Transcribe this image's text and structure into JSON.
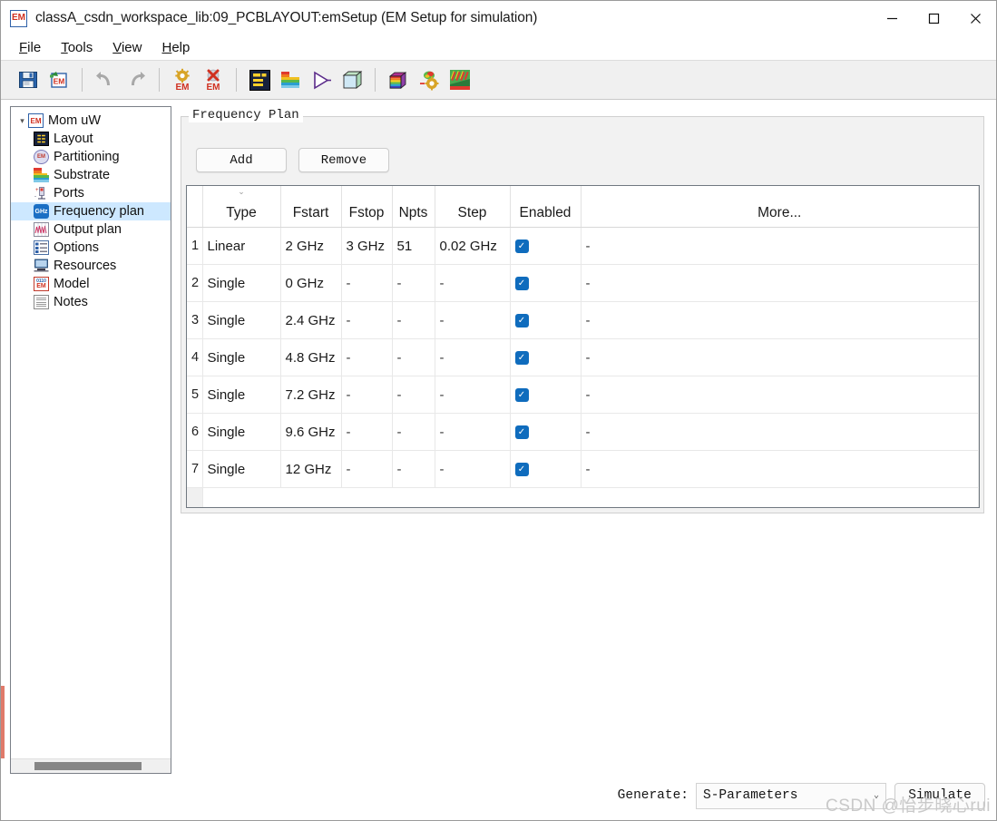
{
  "window": {
    "title": "classA_csdn_workspace_lib:09_PCBLAYOUT:emSetup (EM Setup for simulation)",
    "app_icon_text": "EM",
    "controls": {
      "minimize": "─",
      "maximize": "□",
      "close": "✕"
    }
  },
  "menubar": {
    "items": [
      {
        "mnemonic": "F",
        "rest": "ile"
      },
      {
        "mnemonic": "T",
        "rest": "ools"
      },
      {
        "mnemonic": "V",
        "rest": "iew"
      },
      {
        "mnemonic": "H",
        "rest": "elp"
      }
    ]
  },
  "toolbar": {
    "items": [
      {
        "name": "save-icon"
      },
      {
        "name": "save-em-icon"
      },
      {
        "sep": true
      },
      {
        "name": "undo-icon"
      },
      {
        "name": "redo-icon"
      },
      {
        "sep": true
      },
      {
        "name": "em-settings-icon"
      },
      {
        "name": "em-clear-icon"
      },
      {
        "sep": true
      },
      {
        "name": "layout-icon"
      },
      {
        "name": "substrate-icon"
      },
      {
        "name": "simulate-play-icon"
      },
      {
        "name": "3d-view-icon"
      },
      {
        "sep": true
      },
      {
        "name": "visualization-cube-icon"
      },
      {
        "name": "mesh-settings-icon"
      },
      {
        "name": "em-result-icon"
      }
    ]
  },
  "sidebar": {
    "root": {
      "label": "Mom uW",
      "icon": "em-icon",
      "expanded": true
    },
    "items": [
      {
        "label": "Layout",
        "icon": "layout-icon",
        "selected": false
      },
      {
        "label": "Partitioning",
        "icon": "partitioning-icon",
        "selected": false
      },
      {
        "label": "Substrate",
        "icon": "substrate-icon",
        "selected": false
      },
      {
        "label": "Ports",
        "icon": "ports-icon",
        "selected": false
      },
      {
        "label": "Frequency plan",
        "icon": "frequency-icon",
        "selected": true
      },
      {
        "label": "Output plan",
        "icon": "output-plan-icon",
        "selected": false
      },
      {
        "label": "Options",
        "icon": "options-icon",
        "selected": false
      },
      {
        "label": "Resources",
        "icon": "resources-icon",
        "selected": false
      },
      {
        "label": "Model",
        "icon": "model-icon",
        "selected": false
      },
      {
        "label": "Notes",
        "icon": "notes-icon",
        "selected": false
      }
    ]
  },
  "panel": {
    "legend": "Frequency Plan",
    "add_label": "Add",
    "remove_label": "Remove"
  },
  "table": {
    "columns": [
      "Type",
      "Fstart",
      "Fstop",
      "Npts",
      "Step",
      "Enabled",
      "More..."
    ],
    "sort_indicator": "⌄",
    "checked_glyph": "✓",
    "rows": [
      {
        "idx": "1",
        "type": "Linear",
        "fstart": "2 GHz",
        "fstop": "3 GHz",
        "npts": "51",
        "step": "0.02 GHz",
        "enabled": true,
        "more": "-"
      },
      {
        "idx": "2",
        "type": "Single",
        "fstart": "0 GHz",
        "fstop": "-",
        "npts": "-",
        "step": "-",
        "enabled": true,
        "more": "-"
      },
      {
        "idx": "3",
        "type": "Single",
        "fstart": "2.4 GHz",
        "fstop": "-",
        "npts": "-",
        "step": "-",
        "enabled": true,
        "more": "-"
      },
      {
        "idx": "4",
        "type": "Single",
        "fstart": "4.8 GHz",
        "fstop": "-",
        "npts": "-",
        "step": "-",
        "enabled": true,
        "more": "-"
      },
      {
        "idx": "5",
        "type": "Single",
        "fstart": "7.2 GHz",
        "fstop": "-",
        "npts": "-",
        "step": "-",
        "enabled": true,
        "more": "-"
      },
      {
        "idx": "6",
        "type": "Single",
        "fstart": "9.6 GHz",
        "fstop": "-",
        "npts": "-",
        "step": "-",
        "enabled": true,
        "more": "-"
      },
      {
        "idx": "7",
        "type": "Single",
        "fstart": "12 GHz",
        "fstop": "-",
        "npts": "-",
        "step": "-",
        "enabled": true,
        "more": "-"
      }
    ]
  },
  "footer": {
    "generate_label": "Generate:",
    "generate_value": "S-Parameters",
    "chevron": "⌄",
    "simulate_label": "Simulate"
  },
  "watermark": {
    "text": "CSDN @怡步晓心rui"
  },
  "colors": {
    "accent": "#0f6cbd",
    "selection": "#cde8ff",
    "toolbar_bg": "#f0f0f0",
    "panel_bg": "#f2f2f2",
    "strip": "#e07a6a"
  }
}
